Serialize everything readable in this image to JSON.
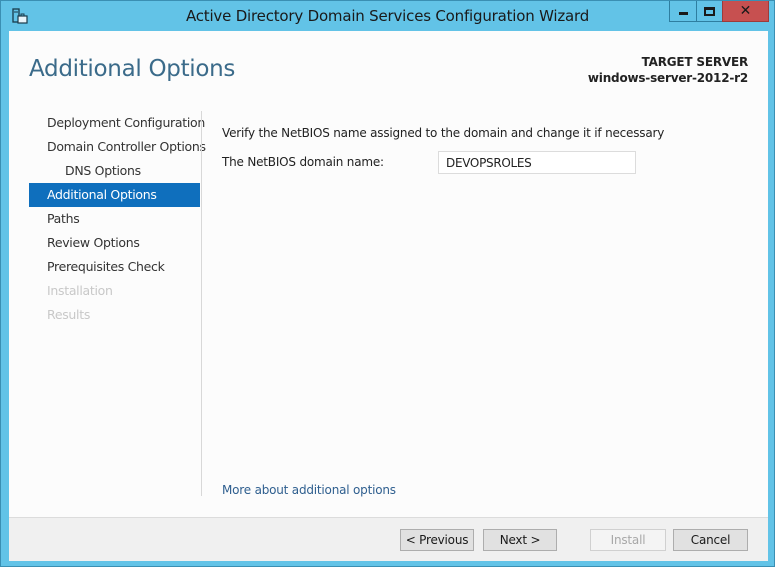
{
  "window": {
    "title": "Active Directory Domain Services Configuration Wizard",
    "icon": "server-manager-icon",
    "controls": [
      "minimize-icon",
      "maximize-icon",
      "close-icon"
    ],
    "close_glyph": "✕"
  },
  "header": {
    "page_title": "Additional Options",
    "target_label": "TARGET SERVER",
    "target_value": "windows-server-2012-r2"
  },
  "nav": {
    "items": [
      {
        "label": "Deployment Configuration",
        "state": "normal"
      },
      {
        "label": "Domain Controller Options",
        "state": "normal"
      },
      {
        "label": "DNS Options",
        "state": "sub"
      },
      {
        "label": "Additional Options",
        "state": "active"
      },
      {
        "label": "Paths",
        "state": "normal"
      },
      {
        "label": "Review Options",
        "state": "normal"
      },
      {
        "label": "Prerequisites Check",
        "state": "normal"
      },
      {
        "label": "Installation",
        "state": "disabled"
      },
      {
        "label": "Results",
        "state": "disabled"
      }
    ]
  },
  "content": {
    "instruction": "Verify the NetBIOS name assigned to the domain and change it if necessary",
    "netbios_label": "The NetBIOS domain name:",
    "netbios_value": "DEVOPSROLES",
    "more_link": "More about additional options"
  },
  "footer": {
    "previous": "< Previous",
    "next": "Next >",
    "install": "Install",
    "cancel": "Cancel"
  },
  "colors": {
    "title_bar": "#62c3e7",
    "close_button": "#c75050",
    "nav_active": "#0f6fbd",
    "page_title": "#3b6b8a",
    "link": "#2f5f8f"
  }
}
